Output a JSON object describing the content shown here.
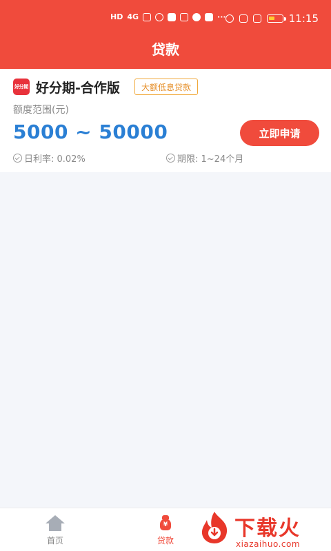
{
  "status_bar": {
    "left_text": "HD",
    "network": "4G",
    "dots": "···",
    "time": "11:15"
  },
  "header": {
    "title": "贷款"
  },
  "product": {
    "logo_text": "好分期",
    "name": "好分期-合作版",
    "tag": "大额低息贷款",
    "range_label": "额度范围(元)",
    "amount_range": "5000 ~ 50000",
    "apply_label": "立即申请",
    "daily_rate": "日利率: 0.02%",
    "term": "期限: 1~24个月"
  },
  "bottom_nav": {
    "items": [
      {
        "label": "首页",
        "icon": "home-icon",
        "active": false
      },
      {
        "label": "贷款",
        "icon": "loan-bag-icon",
        "active": true
      }
    ]
  },
  "watermark": {
    "title": "下载火",
    "site": "xiazaihuo.com"
  },
  "colors": {
    "primary": "#f04b3c",
    "amount": "#2a7fd4",
    "tag_border": "#f0a83a",
    "background": "#f4f6fa"
  }
}
